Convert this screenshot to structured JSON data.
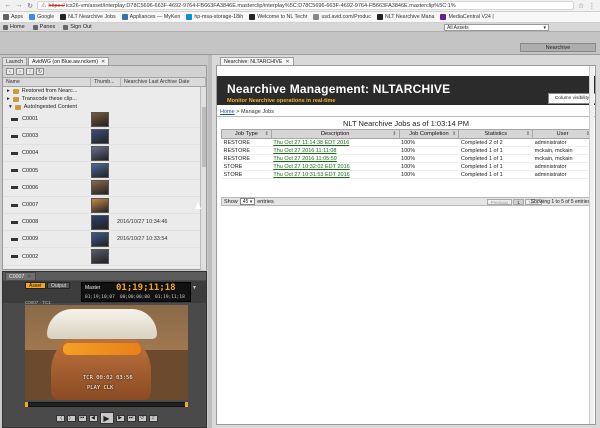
{
  "browser": {
    "url_prefix": "https://",
    "url_rest": "ics26-vm/asset/interplay:D78C5696-663F-4692-9764-FB663FA3846E.masterclip/interplay%5C:D78C5696-663F-4692-9764-FB663FA3846E.masterclip%5C:1%",
    "bookmarks": [
      {
        "label": "Apps",
        "icon": "apps-icon",
        "color": "#5f6368"
      },
      {
        "label": "Google",
        "icon": "google-icon",
        "color": "#4285f4"
      },
      {
        "label": "NLT Nearchive Jobs",
        "icon": "nlt-icon",
        "color": "#222222"
      },
      {
        "label": "Appliances — MyKen",
        "icon": "appliance-icon",
        "color": "#3a6fb0"
      },
      {
        "label": "hp-msa-storage-18ih",
        "icon": "hp-icon",
        "color": "#0096d6"
      },
      {
        "label": "Welcome to NL Techr",
        "icon": "nlt-icon",
        "color": "#222222"
      },
      {
        "label": "usd.avid.com/Produc",
        "icon": "page-icon",
        "color": "#888888"
      },
      {
        "label": "NLT Nearchive Mana",
        "icon": "nlt-icon",
        "color": "#222222"
      },
      {
        "label": "MediaCentral V24 |",
        "icon": "mediacentral-icon",
        "color": "#6a1b9a"
      }
    ]
  },
  "app": {
    "home": "Home",
    "panes": "Panes",
    "signout": "Sign Out",
    "assets_select": "All Assets",
    "nearchive_button": "Nearchive"
  },
  "left_tabs": [
    {
      "label": "Launch"
    },
    {
      "label": "AvidWG (on Blue.aw.nckem)"
    }
  ],
  "bin": {
    "col_name": "Name",
    "col_thumb": "Thumb...",
    "col_date": "Nearchive Last Archive Date",
    "folders": [
      {
        "label": "Restored from Nearc..."
      },
      {
        "label": "Transcode these clip..."
      },
      {
        "label": "AutoIngested Content"
      }
    ],
    "clips": [
      {
        "name": "C0001",
        "date": "",
        "thumb": "#7a5a3a"
      },
      {
        "name": "C0003",
        "date": "",
        "thumb": "#3b4f7a"
      },
      {
        "name": "C0004",
        "date": "",
        "thumb": "#6b6f8a"
      },
      {
        "name": "C0005",
        "date": "",
        "thumb": "#4a6a9a"
      },
      {
        "name": "C0006",
        "date": "",
        "thumb": "#8a6a4a"
      },
      {
        "name": "C0007",
        "date": "",
        "thumb": "#c48a4a"
      },
      {
        "name": "C0008",
        "date": "2016/10/27 10:34:46",
        "thumb": "#2e3f6a"
      },
      {
        "name": "C0009",
        "date": "2016/10/27 10:33:54",
        "thumb": "#3e5a8a"
      },
      {
        "name": "C0002",
        "date": "",
        "thumb": "#5a5a6a"
      }
    ]
  },
  "source": {
    "tab": "C0007",
    "mode_asset": "Asset",
    "mode_output": "Output",
    "sub_label": "C0007 · TC1",
    "tc_label": "Master",
    "tc_main": "01;19;11;18",
    "tc_in": "01;19;10;07",
    "tc_out": "00;00;00;00",
    "tc_dur": "01;19;11;18",
    "overlay1": "TCR 00:02 03:56",
    "overlay2": "PLAY   CLK"
  },
  "right": {
    "tab": "Nearchive: NLTARCHIVE",
    "title": "Nearchive Management: NLTARCHIVE",
    "subtitle": "Monitor Nearchive operations in real-time",
    "col_visibility": "Column visibility",
    "crumb_home": "Home",
    "crumb_sep": " > ",
    "crumb_page": "Manage Jobs",
    "jobs_title": "NLT Nearchive Jobs as of 1:03:14 PM",
    "columns": [
      "Job Type",
      "Description",
      "Job Completion",
      "Statistics",
      "User"
    ],
    "jobs": [
      {
        "type": "RESTORE",
        "desc": "Thu Oct 27 11:14:38 EDT 2016",
        "completion": "100%",
        "stats": "Completed 2 of 2",
        "user": "administrator"
      },
      {
        "type": "RESTORE",
        "desc": "Thu Oct 27 2016 11:11:08",
        "completion": "100%",
        "stats": "Completed 1 of 1",
        "user": "mckain, mckain"
      },
      {
        "type": "RESTORE",
        "desc": "Thu Oct 27 2016 11:05:59",
        "completion": "100%",
        "stats": "Completed 1 of 1",
        "user": "mckain, mckain"
      },
      {
        "type": "STORE",
        "desc": "Thu Oct 27 10:32:02 EDT 2016",
        "completion": "100%",
        "stats": "Completed 1 of 1",
        "user": "administrator"
      },
      {
        "type": "STORE",
        "desc": "Thu Oct 27 10:31:53 EDT 2016",
        "completion": "100%",
        "stats": "Completed 1 of 1",
        "user": "administrator"
      }
    ],
    "show_label": "Show",
    "show_value": "45",
    "entries_label": "entries",
    "prev": "Previous",
    "page": "1",
    "next": "Next",
    "info": "Showing 1 to 5 of 5 entries"
  }
}
